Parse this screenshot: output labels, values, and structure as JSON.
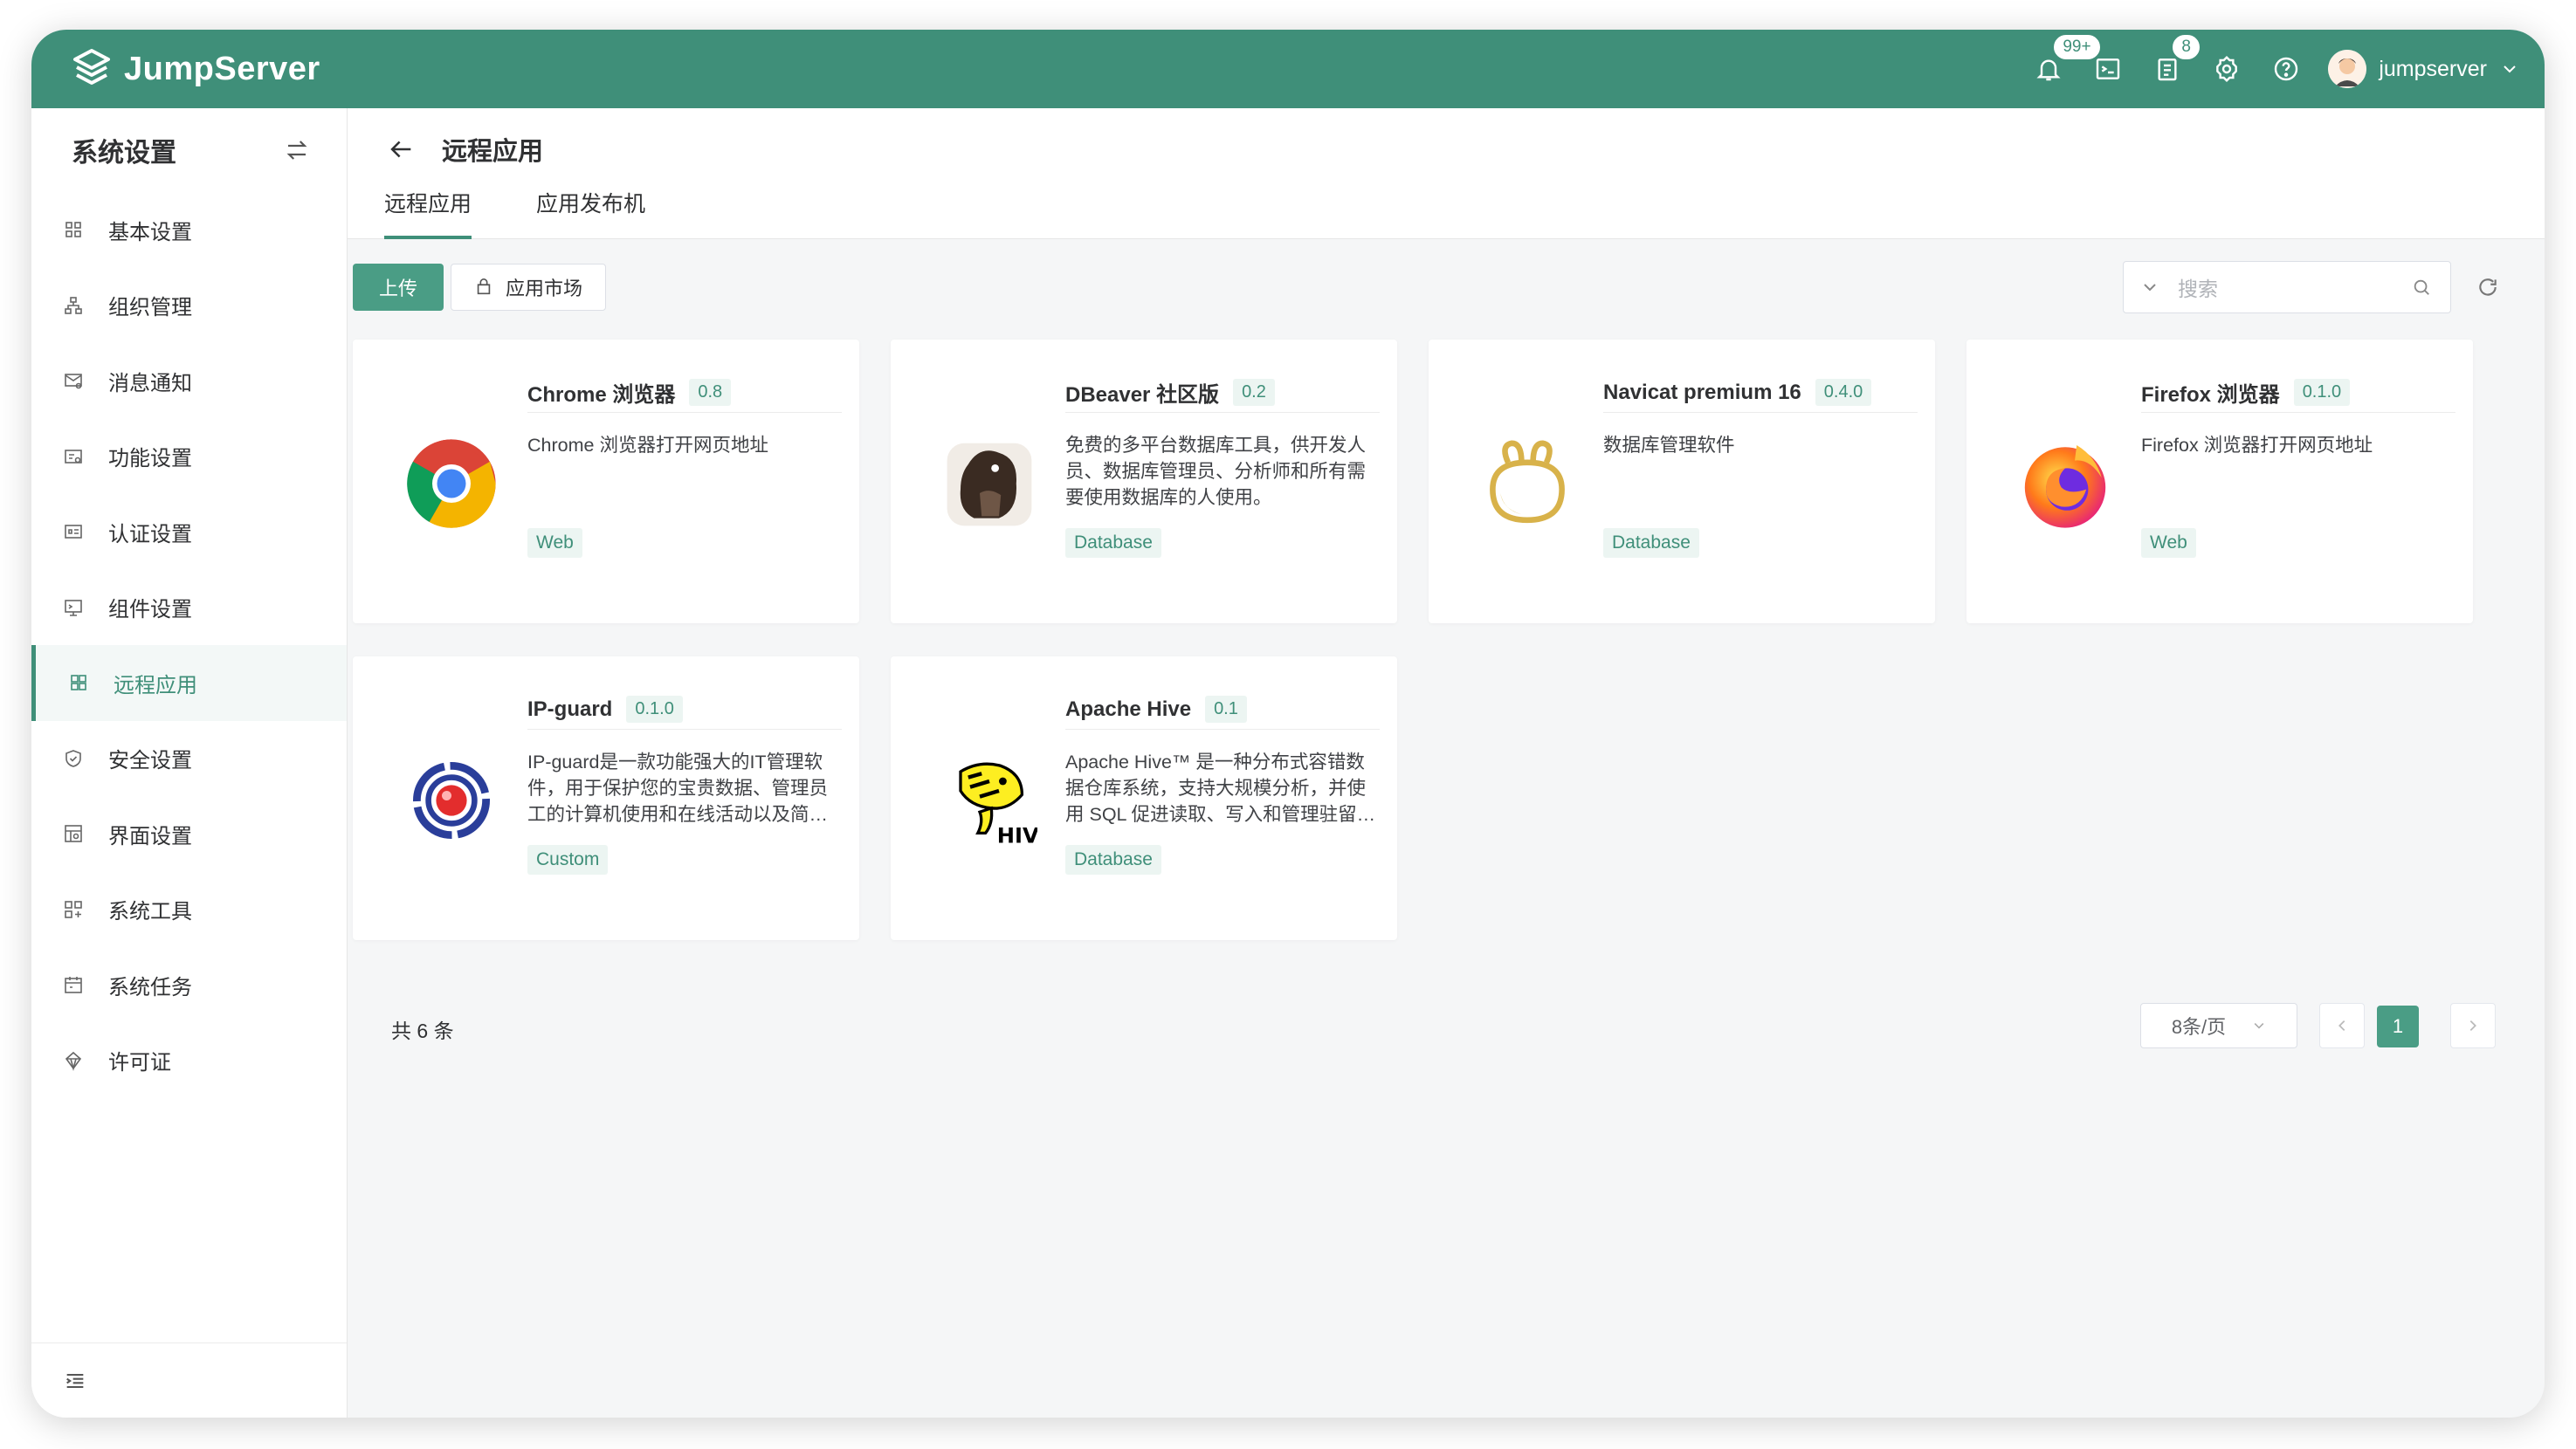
{
  "header": {
    "brand": "JumpServer",
    "notification_badge": "99+",
    "ticket_badge": "8",
    "user_name": "jumpserver"
  },
  "sidebar": {
    "title": "系统设置",
    "items": [
      {
        "label": "基本设置",
        "icon": "grid-icon"
      },
      {
        "label": "组织管理",
        "icon": "org-icon"
      },
      {
        "label": "消息通知",
        "icon": "message-icon"
      },
      {
        "label": "功能设置",
        "icon": "feature-icon"
      },
      {
        "label": "认证设置",
        "icon": "auth-icon"
      },
      {
        "label": "组件设置",
        "icon": "component-icon"
      },
      {
        "label": "远程应用",
        "icon": "apps-icon",
        "active": true
      },
      {
        "label": "安全设置",
        "icon": "shield-icon"
      },
      {
        "label": "界面设置",
        "icon": "layout-icon"
      },
      {
        "label": "系统工具",
        "icon": "tools-icon"
      },
      {
        "label": "系统任务",
        "icon": "calendar-icon"
      },
      {
        "label": "许可证",
        "icon": "license-icon"
      }
    ]
  },
  "main": {
    "title": "远程应用",
    "tabs": [
      {
        "label": "远程应用",
        "active": true
      },
      {
        "label": "应用发布机"
      }
    ],
    "upload_label": "上传",
    "market_label": "应用市场",
    "search_placeholder": "搜索",
    "apps": [
      {
        "name": "Chrome 浏览器",
        "version": "0.8",
        "desc": "Chrome 浏览器打开网页地址",
        "tag": "Web",
        "icon": "chrome-icon"
      },
      {
        "name": "DBeaver 社区版",
        "version": "0.2",
        "desc": "免费的多平台数据库工具，供开发人员、数据库管理员、分析师和所有需要使用数据库的人使用。",
        "tag": "Database",
        "icon": "dbeaver-icon"
      },
      {
        "name": "Navicat premium 16",
        "version": "0.4.0",
        "desc": "数据库管理软件",
        "tag": "Database",
        "icon": "navicat-icon"
      },
      {
        "name": "Firefox 浏览器",
        "version": "0.1.0",
        "desc": "Firefox 浏览器打开网页地址",
        "tag": "Web",
        "icon": "firefox-icon"
      },
      {
        "name": "IP-guard",
        "version": "0.1.0",
        "desc": "IP-guard是一款功能强大的IT管理软件，用于保护您的宝贵数据、管理员工的计算机使用和在线活动以及简化IT管理。",
        "tag": "Custom",
        "icon": "ipguard-icon"
      },
      {
        "name": "Apache Hive",
        "version": "0.1",
        "desc": "Apache Hive™ 是一种分布式容错数据仓库系统，支持大规模分析，并使用 SQL 促进读取、写入和管理驻留在分布式存储中的PB级数据。",
        "tag": "Database",
        "icon": "hive-icon"
      }
    ],
    "total_label": "共 6 条",
    "page_size_label": "8条/页",
    "current_page": "1"
  }
}
